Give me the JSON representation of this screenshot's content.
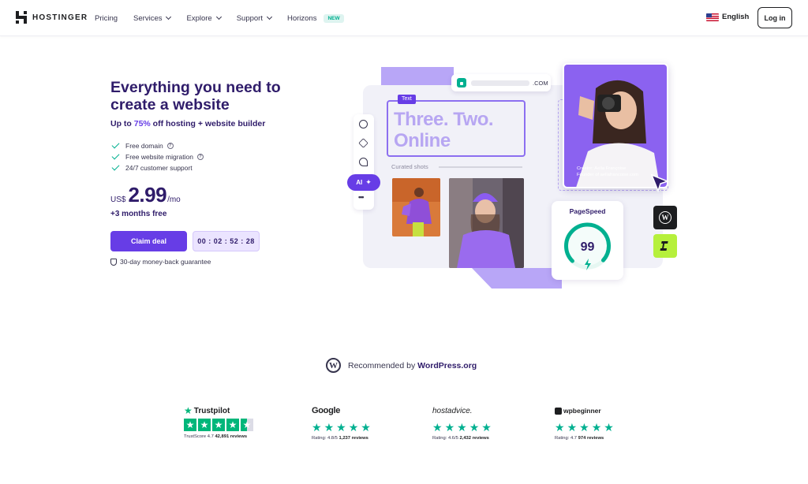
{
  "nav": {
    "brand": "HOSTINGER",
    "links": [
      "Pricing",
      "Services",
      "Explore",
      "Support",
      "Horizons"
    ],
    "new_badge": "NEW",
    "language": "English",
    "login": "Log in"
  },
  "hero": {
    "title": "Everything you need to create a website",
    "subtitle_prefix": "Up to ",
    "subtitle_pct": "75%",
    "subtitle_suffix": " off hosting + website builder",
    "features": [
      "Free domain",
      "Free website migration",
      "24/7 customer support"
    ],
    "currency": "US$",
    "price": "2.99",
    "period": "/mo",
    "bonus": "+3 months free",
    "cta": "Claim deal",
    "timer": "00 : 02 : 52 : 28",
    "guarantee": "30-day money-back guarantee"
  },
  "illustration": {
    "domain": ".COM",
    "text_tag": "Text",
    "headline": "Three. Two. Online",
    "curated": "Curated shots",
    "ai_label": "AI",
    "creator_name": "Creator: Aella Françoise",
    "creator_role": "Founder of aellafrancoise.com",
    "pagespeed_label": "PageSpeed",
    "pagespeed_score": "99",
    "pagespeed_fraction": 0.99
  },
  "recommend": {
    "prefix": "Recommended by ",
    "brand": "WordPress.org"
  },
  "ratings": [
    {
      "brand": "Trustpilot",
      "meta_label": "TrustScore 4.7",
      "meta_value": "42,891 reviews",
      "stars": 4.5
    },
    {
      "brand": "Google",
      "meta_label": "Rating: 4.8/5",
      "meta_value": "1,237 reviews",
      "stars": 5
    },
    {
      "brand": "hostadvice.",
      "meta_label": "Rating: 4.6/5",
      "meta_value": "2,432 reviews",
      "stars": 5
    },
    {
      "brand": "wpbeginner",
      "meta_label": "Rating: 4.7",
      "meta_value": "974 reviews",
      "stars": 5
    }
  ],
  "colors": {
    "brand_purple": "#673de6",
    "navy": "#2f1c6a",
    "green": "#00b090",
    "trustpilot_green": "#00b67a"
  }
}
